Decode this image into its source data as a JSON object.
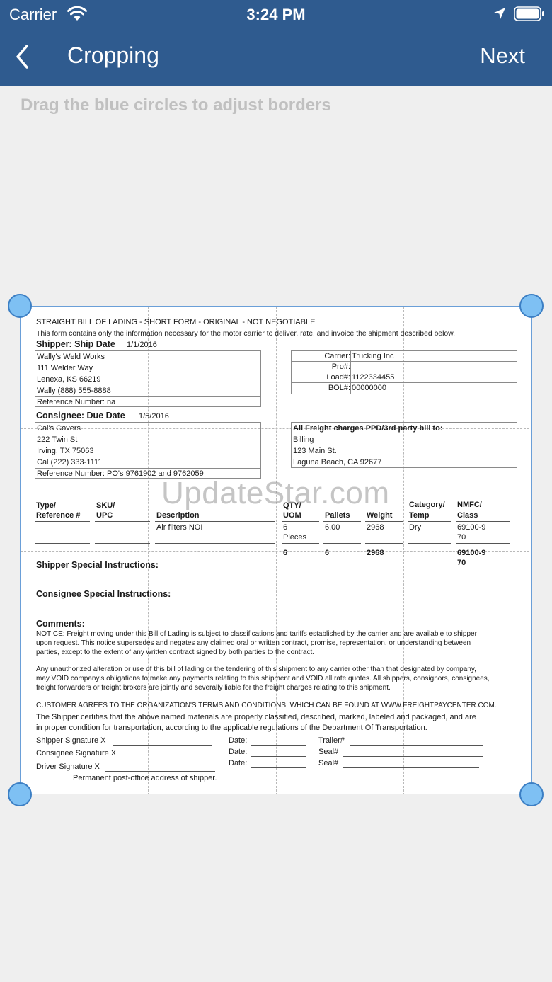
{
  "status": {
    "carrier": "Carrier",
    "time": "3:24 PM"
  },
  "nav": {
    "title": "Cropping",
    "next": "Next"
  },
  "hint": "Drag the blue circles to adjust borders",
  "watermark": "UpdateStar.com",
  "icons": {
    "wifi": "wifi-icon",
    "location": "location-arrow-icon",
    "battery": "battery-icon",
    "back": "chevron-left-icon"
  },
  "colors": {
    "nav_bg": "#2f5b8f",
    "handle": "#7ec0f3",
    "handle_border": "#3c7fc4"
  },
  "doc": {
    "title": "STRAIGHT BILL OF LADING - SHORT FORM - ORIGINAL - NOT NEGOTIABLE",
    "subtitle": "This form contains only the information necessary for the motor carrier to deliver, rate, and invoice the shipment described below.",
    "shipper_label": "Shipper: Ship Date",
    "ship_date": "1/1/2016",
    "shipper": [
      "Wally's Weld Works",
      "111 Welder Way",
      "Lenexa, KS 66219",
      "Wally (888) 555-8888"
    ],
    "shipper_ref": "Reference Number: na",
    "carrier_info": [
      {
        "label": "Carrier:",
        "value": "Trucking Inc"
      },
      {
        "label": "Pro#:",
        "value": ""
      },
      {
        "label": "Load#:",
        "value": "1122334455"
      },
      {
        "label": "BOL#:",
        "value": "00000000"
      }
    ],
    "consignee_label": "Consignee: Due Date",
    "due_date": "1/5/2016",
    "consignee": [
      "Cal's Covers",
      "222 Twin St",
      "Irving, TX 75063",
      "Cal (222) 333-1111"
    ],
    "consignee_ref": "Reference Number: PO's 9761902 and 9762059",
    "freight_title": "All Freight charges PPD/3rd party bill to:",
    "billing": [
      "Billing",
      "123 Main St.",
      "Laguna Beach, CA 92677"
    ],
    "headers": {
      "type": [
        "Type/",
        "Reference #"
      ],
      "sku": [
        "SKU/",
        "UPC"
      ],
      "description": "Description",
      "qty": [
        "QTY/",
        "UOM"
      ],
      "pallets": "Pallets",
      "weight": "Weight",
      "category": [
        "Category/",
        "Temp"
      ],
      "nmfc": [
        "NMFC/",
        "Class"
      ]
    },
    "row": {
      "description": "Air filters NOI",
      "qty": "6",
      "uom": "Pieces",
      "pallets": "6.00",
      "weight": "2968",
      "category": "Dry",
      "nmfc": "69100-9",
      "class": "70"
    },
    "totals": {
      "qty": "6",
      "pallets": "6",
      "weight": "2968",
      "nmfc": "69100-9",
      "class": "70"
    },
    "shipper_instructions": "Shipper Special Instructions:",
    "consignee_instructions": "Consignee Special Instructions:",
    "comments": "Comments:",
    "notice": [
      "NOTICE: Freight moving under this Bill of Lading is subject to classifications and tariffs established by the carrier and are available to shipper",
      "upon request. This notice supersedes and negates any claimed oral or written contract, promise, representation, or understanding between",
      "parties, except to the extent of any written contract signed by both parties to the contract."
    ],
    "alteration": [
      "Any unauthorized alteration or use of this bill of lading or the tendering of this shipment to any carrier other than that designated by company,",
      "may VOID company's obligations to make any payments relating to this shipment and VOID all rate quotes. All shippers, consignors, consignees,",
      "freight forwarders or freight brokers are jointly and severally liable for the freight charges relating to this shipment."
    ],
    "terms": "CUSTOMER AGREES TO THE ORGANIZATION'S TERMS AND CONDITIONS, WHICH CAN BE FOUND AT WWW.FREIGHTPAYCENTER.COM.",
    "certify": [
      "The Shipper certifies that the above named materials are properly classified, described, marked, labeled and packaged, and are",
      "in proper condition for transportation, according to the applicable regulations of the Department Of Transportation."
    ],
    "signatures": {
      "shipper": "Shipper Signature X",
      "consignee": "Consignee Signature X",
      "driver": "Driver Signature X",
      "date": "Date:",
      "trailer": "Trailer#",
      "seal": "Seal#"
    },
    "footer": "Permanent post-office address of shipper."
  }
}
